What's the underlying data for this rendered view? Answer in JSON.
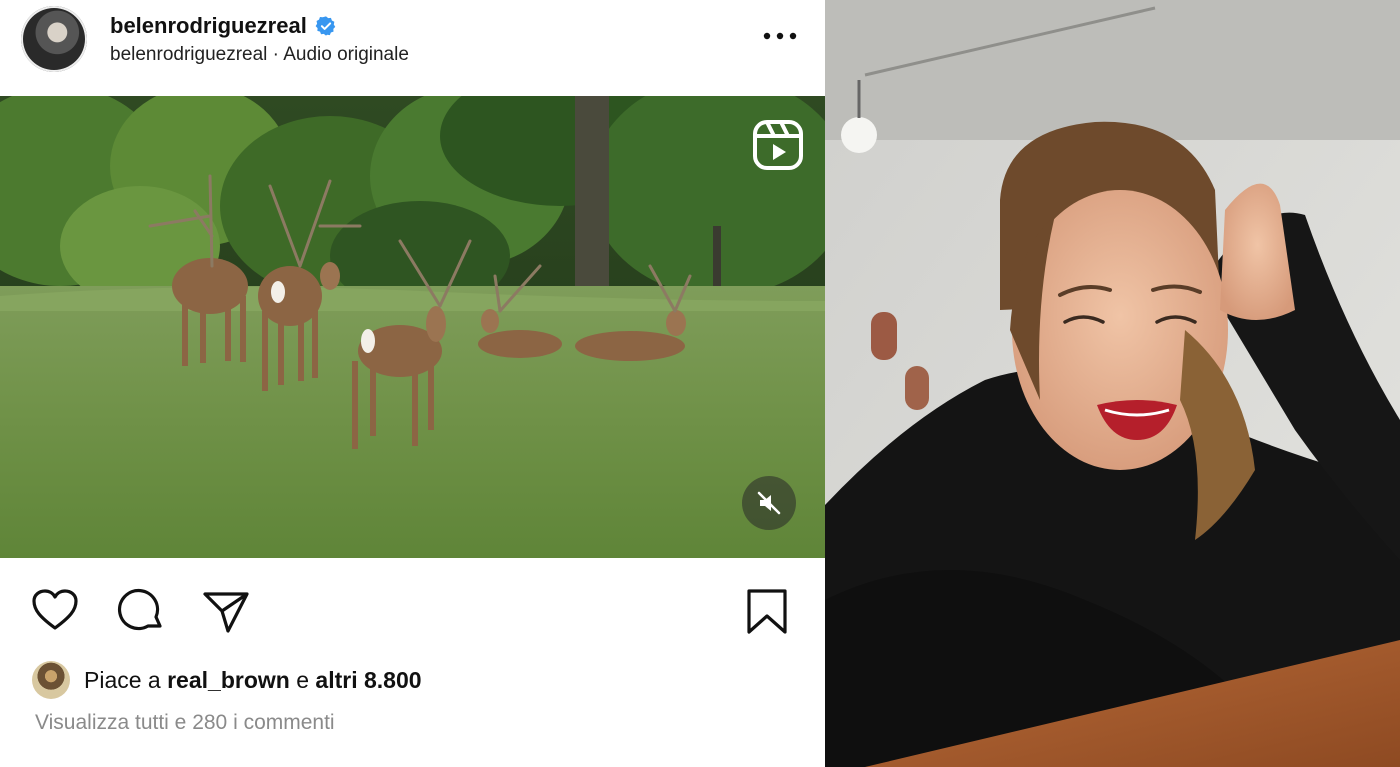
{
  "post": {
    "username": "belenrodriguezreal",
    "subline": "belenrodriguezreal · Audio originale",
    "verified": true,
    "likes": {
      "prefix": "Piace a ",
      "user": "real_brown",
      "middle": " e ",
      "others": "altri 8.800"
    },
    "comments_link": "Visualizza tutti e 280 i commenti"
  },
  "icons": {
    "avatar": "profile-avatar",
    "verified": "verified-badge-icon",
    "more": "more-options-icon",
    "reel": "reel-icon",
    "mute": "muted-speaker-icon",
    "like": "heart-icon",
    "comment": "comment-icon",
    "share": "send-icon",
    "save": "bookmark-icon"
  },
  "colors": {
    "verified": "#3897f0",
    "text": "#111111",
    "muted_text": "#8a8a8a"
  }
}
